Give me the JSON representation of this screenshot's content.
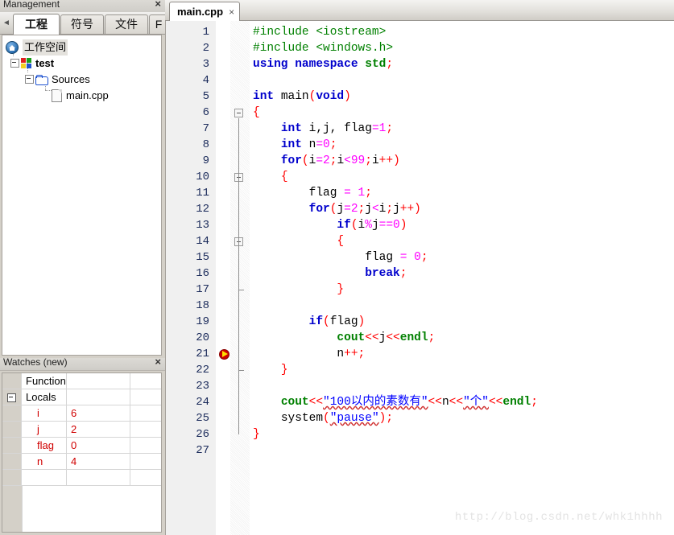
{
  "management_panel": {
    "title": "Management",
    "close_label": "×",
    "scroll_left": "◄",
    "scroll_right": "►",
    "tabs": [
      {
        "label": "工程",
        "selected": true
      },
      {
        "label": "符号",
        "selected": false
      },
      {
        "label": "文件",
        "selected": false
      },
      {
        "label": "F",
        "selected": false
      }
    ],
    "tree": [
      {
        "label": "工作空间",
        "icon": "home-icon",
        "depth": 0,
        "selected": true,
        "bold": false
      },
      {
        "label": "test",
        "icon": "project-icon",
        "depth": 1,
        "selected": false,
        "bold": true
      },
      {
        "label": "Sources",
        "icon": "folder-icon",
        "depth": 2,
        "selected": false,
        "bold": false
      },
      {
        "label": "main.cpp",
        "icon": "file-icon",
        "depth": 3,
        "selected": false,
        "bold": false
      }
    ]
  },
  "watches_panel": {
    "title": "Watches (new)",
    "close_label": "×",
    "rows": [
      {
        "name": "Function",
        "value": "",
        "indent": false,
        "expander": false,
        "is_var": false
      },
      {
        "name": "Locals",
        "value": "",
        "indent": false,
        "expander": true,
        "is_var": false
      },
      {
        "name": "i",
        "value": "6",
        "indent": true,
        "expander": false,
        "is_var": true
      },
      {
        "name": "j",
        "value": "2",
        "indent": true,
        "expander": false,
        "is_var": true
      },
      {
        "name": "flag",
        "value": "0",
        "indent": true,
        "expander": false,
        "is_var": true
      },
      {
        "name": "n",
        "value": "4",
        "indent": true,
        "expander": false,
        "is_var": true
      },
      {
        "name": "",
        "value": "",
        "indent": false,
        "expander": false,
        "is_var": false
      }
    ]
  },
  "editor": {
    "tab": {
      "label": "main.cpp",
      "close_label": "×"
    },
    "marker_line": 21,
    "fold_boxes": [
      6,
      10,
      14
    ],
    "fold_ends": [
      17,
      22
    ],
    "lines": [
      {
        "n": 1,
        "text": "#include <iostream>"
      },
      {
        "n": 2,
        "text": "#include <windows.h>"
      },
      {
        "n": 3,
        "text": "using namespace std;"
      },
      {
        "n": 4,
        "text": ""
      },
      {
        "n": 5,
        "text": "int main(void)"
      },
      {
        "n": 6,
        "text": "{"
      },
      {
        "n": 7,
        "text": "    int i,j, flag=1;"
      },
      {
        "n": 8,
        "text": "    int n=0;"
      },
      {
        "n": 9,
        "text": "    for(i=2;i<99;i++)"
      },
      {
        "n": 10,
        "text": "    {"
      },
      {
        "n": 11,
        "text": "        flag = 1;"
      },
      {
        "n": 12,
        "text": "        for(j=2;j<i;j++)"
      },
      {
        "n": 13,
        "text": "            if(i%j==0)"
      },
      {
        "n": 14,
        "text": "            {"
      },
      {
        "n": 15,
        "text": "                flag = 0;"
      },
      {
        "n": 16,
        "text": "                break;"
      },
      {
        "n": 17,
        "text": "            }"
      },
      {
        "n": 18,
        "text": ""
      },
      {
        "n": 19,
        "text": "        if(flag)"
      },
      {
        "n": 20,
        "text": "            cout<<j<<endl;"
      },
      {
        "n": 21,
        "text": "            n++;"
      },
      {
        "n": 22,
        "text": "    }"
      },
      {
        "n": 23,
        "text": ""
      },
      {
        "n": 24,
        "text": "    cout<<\"100以内的素数有\"<<n<<\"个\"<<endl;"
      },
      {
        "n": 25,
        "text": "    system(\"pause\");"
      },
      {
        "n": 26,
        "text": "}"
      },
      {
        "n": 27,
        "text": ""
      }
    ]
  },
  "watermark": {
    "text": "http://blog.csdn.net/whk1hhhh"
  },
  "colors": {
    "keyword": "#0000cc",
    "preprocessor": "#008000",
    "number": "#ff00ff",
    "operator": "#ff0000",
    "string": "#0000ff",
    "variable_red": "#d00000",
    "panel_bg": "#d4d0c8"
  }
}
